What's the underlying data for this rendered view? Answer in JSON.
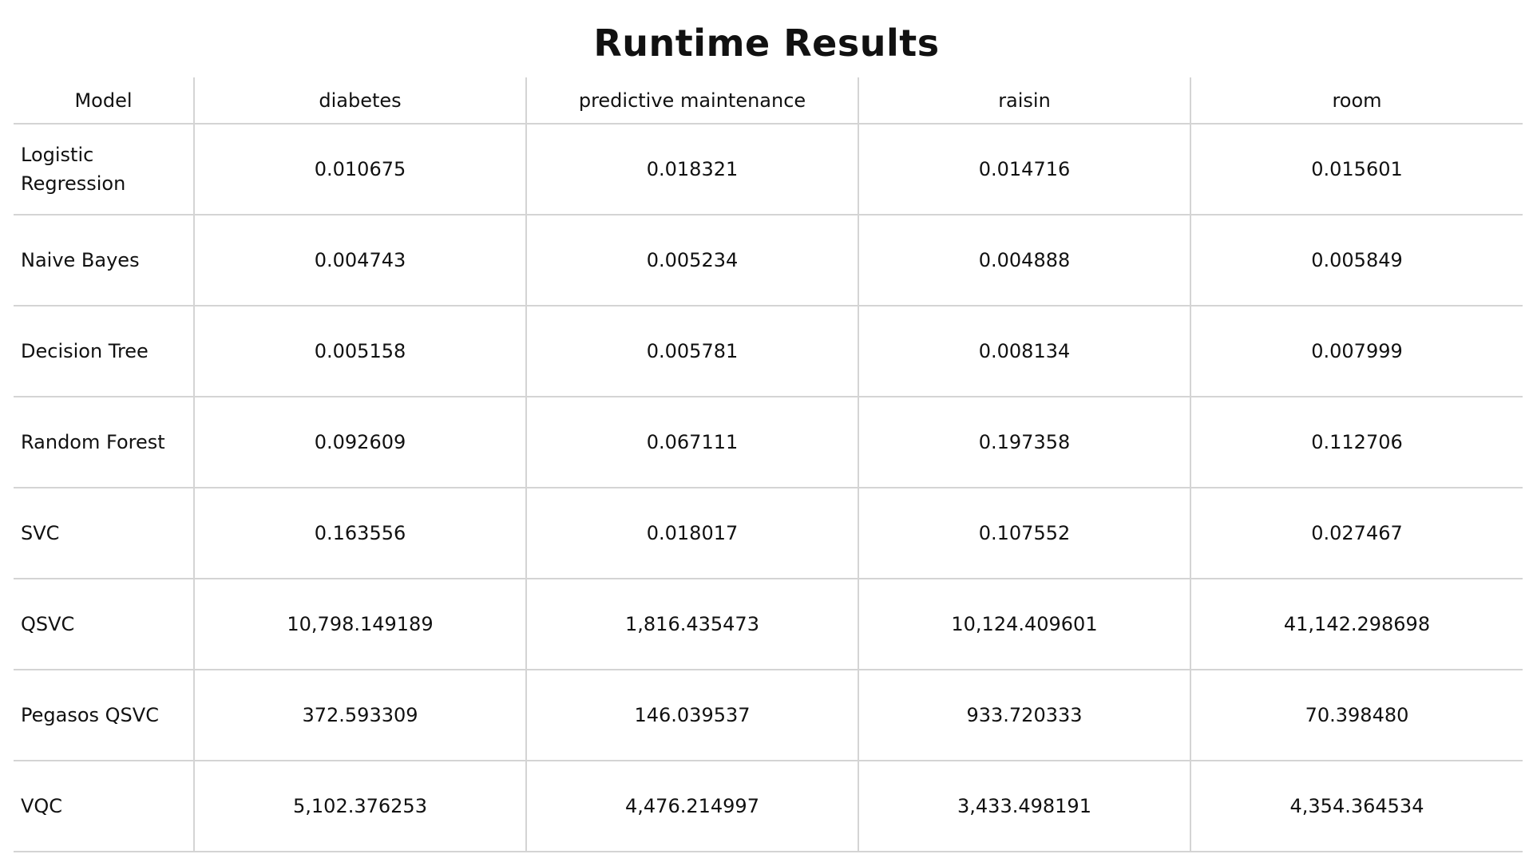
{
  "chart_data": {
    "type": "table",
    "title": "Runtime Results",
    "columns": [
      "Model",
      "diabetes",
      "predictive maintenance",
      "raisin",
      "room"
    ],
    "rows": [
      {
        "model": "Logistic Regression",
        "values": [
          "0.010675",
          "0.018321",
          "0.014716",
          "0.015601"
        ]
      },
      {
        "model": "Naive Bayes",
        "values": [
          "0.004743",
          "0.005234",
          "0.004888",
          "0.005849"
        ]
      },
      {
        "model": "Decision Tree",
        "values": [
          "0.005158",
          "0.005781",
          "0.008134",
          "0.007999"
        ]
      },
      {
        "model": "Random Forest",
        "values": [
          "0.092609",
          "0.067111",
          "0.197358",
          "0.112706"
        ]
      },
      {
        "model": "SVC",
        "values": [
          "0.163556",
          "0.018017",
          "0.107552",
          "0.027467"
        ]
      },
      {
        "model": "QSVC",
        "values": [
          "10,798.149189",
          "1,816.435473",
          "10,124.409601",
          "41,142.298698"
        ]
      },
      {
        "model": "Pegasos QSVC",
        "values": [
          "372.593309",
          "146.039537",
          "933.720333",
          "70.398480"
        ]
      },
      {
        "model": "VQC",
        "values": [
          "5,102.376253",
          "4,476.214997",
          "3,433.498191",
          "4,354.364534"
        ]
      }
    ]
  }
}
